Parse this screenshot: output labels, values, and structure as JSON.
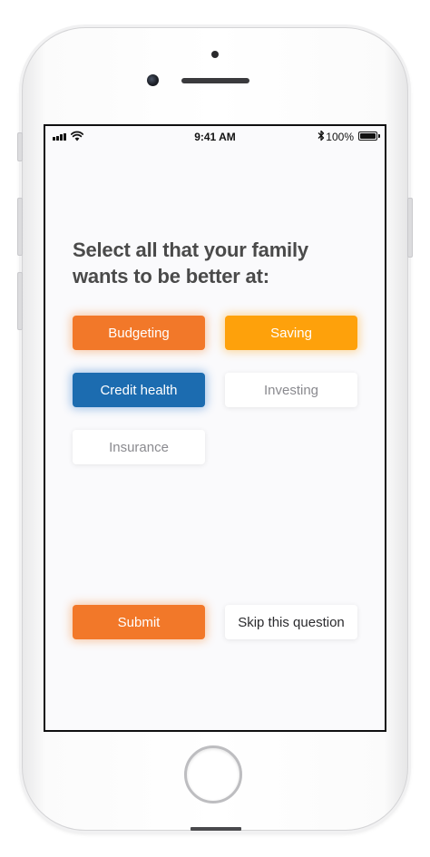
{
  "status_bar": {
    "time": "9:41 AM",
    "battery_percent": "100%",
    "battery_level": 1.0,
    "signal_icon": "signal-bars-icon",
    "wifi_icon": "wifi-icon",
    "bluetooth_icon": "bluetooth-icon"
  },
  "question": {
    "title": "Select all that your family wants to be better at:"
  },
  "options": [
    {
      "label": "Budgeting",
      "selected": true,
      "color": "#F27829"
    },
    {
      "label": "Saving",
      "selected": true,
      "color": "#FEA10B"
    },
    {
      "label": "Credit health",
      "selected": true,
      "color": "#1C6CB0"
    },
    {
      "label": "Investing",
      "selected": false,
      "color": "#FFFFFF"
    },
    {
      "label": "Insurance",
      "selected": false,
      "color": "#FFFFFF"
    }
  ],
  "actions": {
    "submit_label": "Submit",
    "submit_color": "#F27829",
    "skip_label": "Skip this question"
  },
  "colors": {
    "accent": "#F27829",
    "text_primary": "#4A4A4A",
    "text_muted": "#8A8A8F",
    "screen_background": "#FAFAFC"
  }
}
